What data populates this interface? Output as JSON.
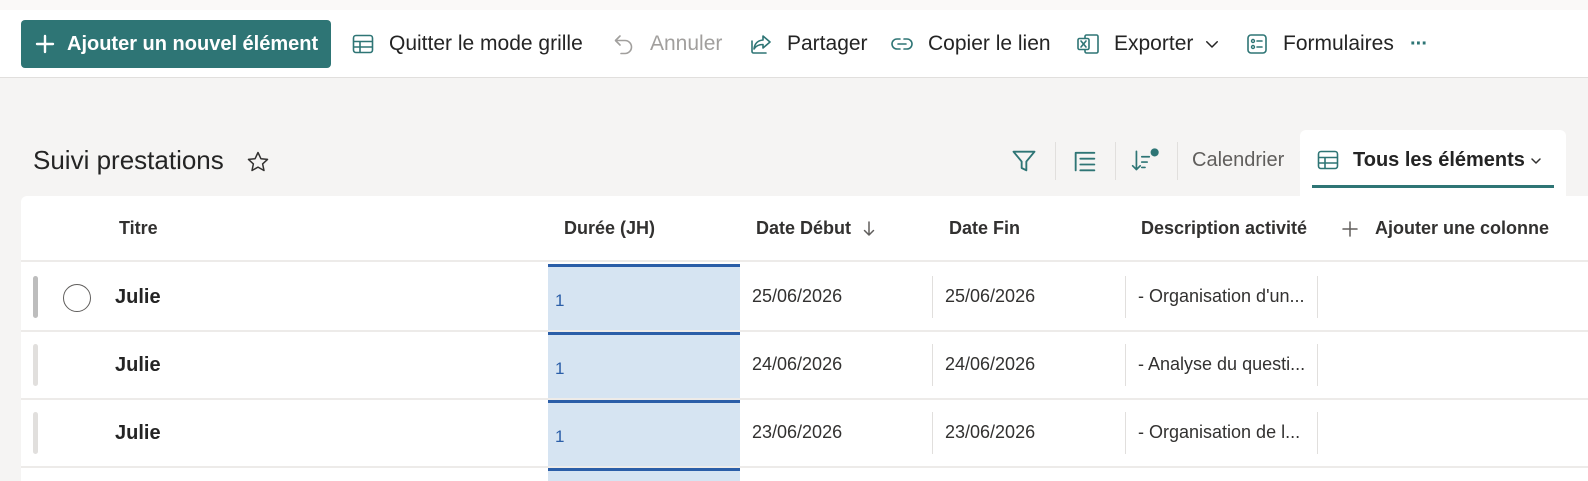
{
  "commandbar": {
    "new_item": "Ajouter un nouvel élément",
    "exit_grid": "Quitter le mode grille",
    "undo": "Annuler",
    "share": "Partager",
    "copy_link": "Copier le lien",
    "export": "Exporter",
    "forms": "Formulaires",
    "more": "···"
  },
  "list": {
    "title": "Suivi prestations"
  },
  "views": {
    "calendar": "Calendrier",
    "current": "Tous les éléments"
  },
  "columns": {
    "title": "Titre",
    "duration": "Durée (JH)",
    "start": "Date Début",
    "end": "Date Fin",
    "description": "Description activité",
    "add_column": "Ajouter une colonne"
  },
  "rows": [
    {
      "title": "Julie",
      "duration": "1",
      "start": "25/06/2026",
      "end": "25/06/2026",
      "description": "- Organisation d'un..."
    },
    {
      "title": "Julie",
      "duration": "1",
      "start": "24/06/2026",
      "end": "24/06/2026",
      "description": "- Analyse du questi..."
    },
    {
      "title": "Julie",
      "duration": "1",
      "start": "23/06/2026",
      "end": "23/06/2026",
      "description": "- Organisation de l..."
    }
  ],
  "colors": {
    "accent": "#2e7575",
    "selection": "#d6e4f2",
    "selection_border": "#2b5ea8"
  },
  "icons": {
    "new_item": "plus-icon",
    "exit_grid": "grid-icon",
    "undo": "undo-icon",
    "share": "share-icon",
    "copy_link": "link-icon",
    "export": "excel-icon",
    "forms": "forms-icon",
    "favorite": "star-icon",
    "filter": "filter-icon",
    "group": "list-icon",
    "sort": "sort-icon",
    "view": "grid-icon"
  }
}
